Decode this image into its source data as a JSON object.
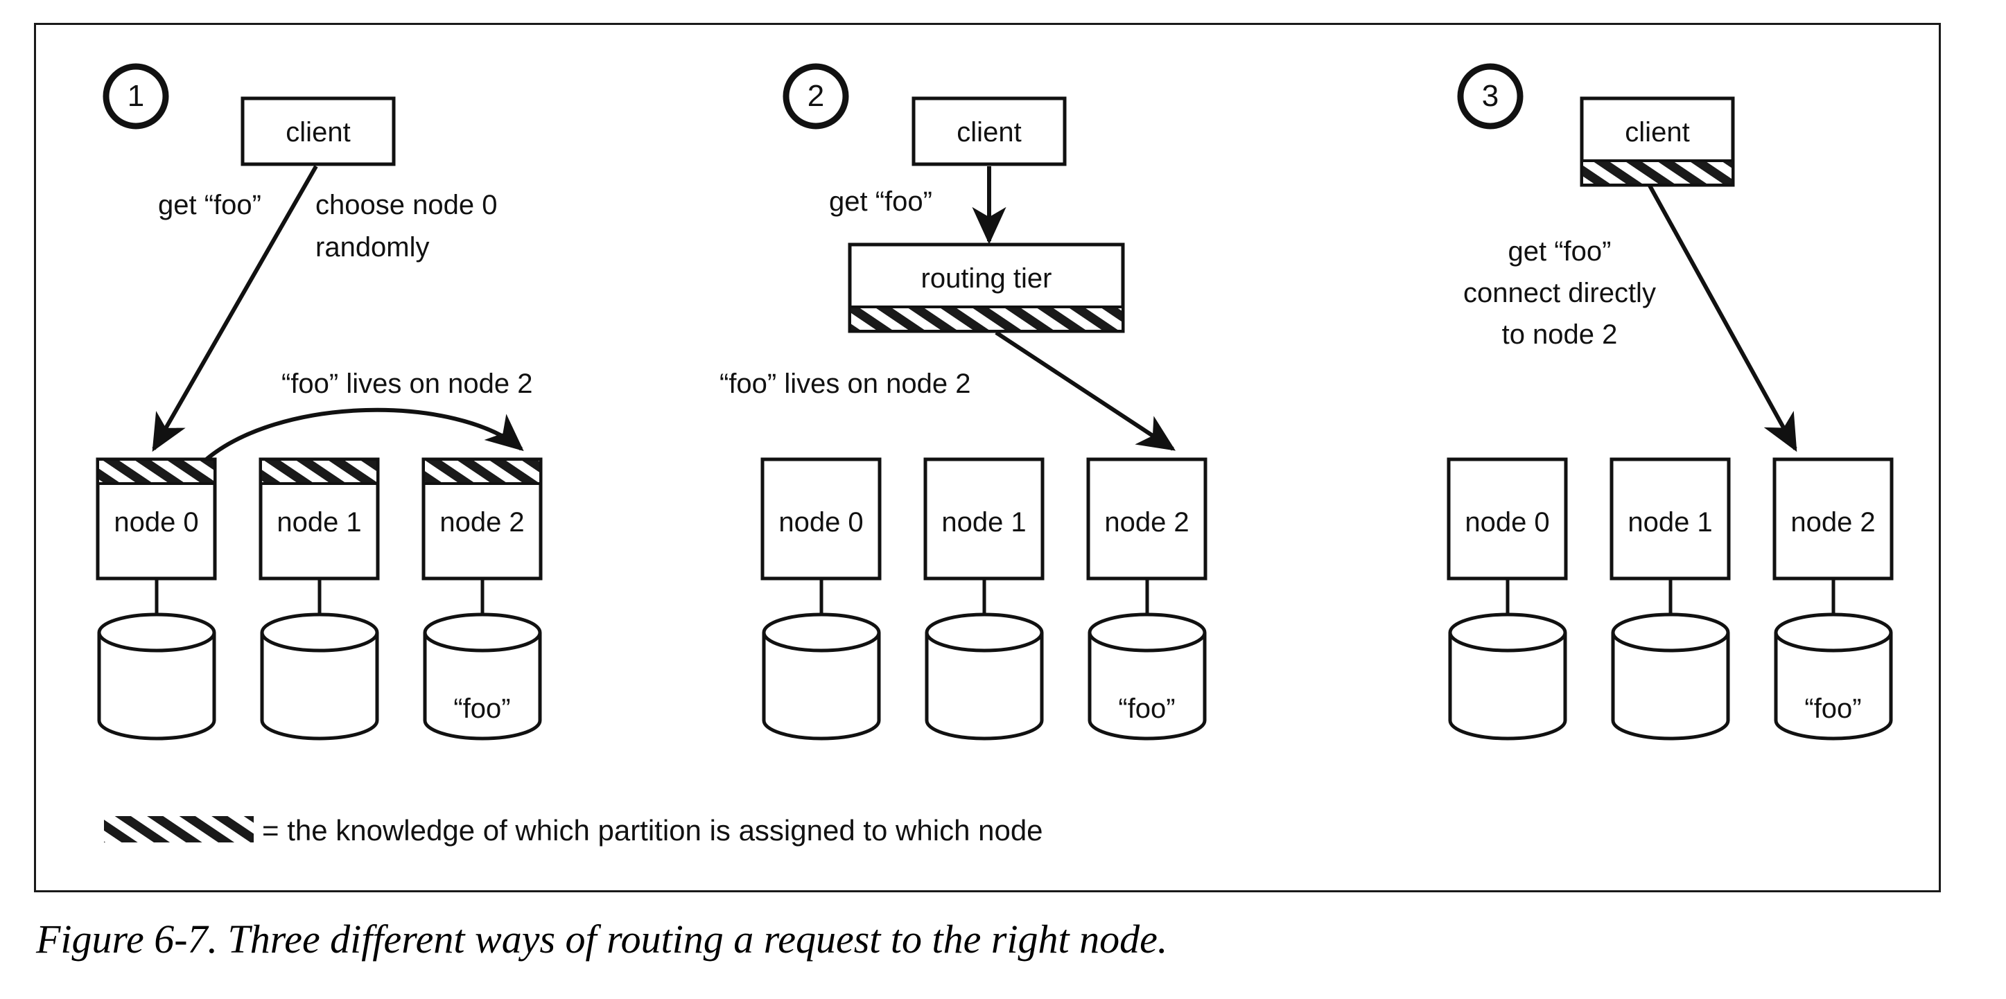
{
  "figure": {
    "caption": "Figure 6-7. Three different ways of routing a request to the right node.",
    "frame_color": "#1a1a1a",
    "background": "#ffffff"
  },
  "legend": {
    "swatch_name": "hatched-bar",
    "text": "= the knowledge of which partition is assigned to which node"
  },
  "panels": [
    {
      "number": "1",
      "client": {
        "label": "client",
        "hatched": false,
        "hatch_position": "none"
      },
      "annotations": [
        {
          "name": "request-label",
          "text": "get “foo”"
        },
        {
          "name": "choose-label-line1",
          "text": "choose node 0"
        },
        {
          "name": "choose-label-line2",
          "text": "randomly"
        },
        {
          "name": "forward-label",
          "text": "“foo” lives on node 2"
        }
      ],
      "nodes": [
        {
          "label": "node 0",
          "hatched": true,
          "hatch_position": "top",
          "store_label": ""
        },
        {
          "label": "node 1",
          "hatched": true,
          "hatch_position": "top",
          "store_label": ""
        },
        {
          "label": "node 2",
          "hatched": true,
          "hatch_position": "top",
          "store_label": "“foo”"
        }
      ]
    },
    {
      "number": "2",
      "client": {
        "label": "client",
        "hatched": false,
        "hatch_position": "none"
      },
      "router": {
        "label": "routing tier",
        "hatched": true,
        "hatch_position": "bottom"
      },
      "annotations": [
        {
          "name": "request-label",
          "text": "get “foo”"
        },
        {
          "name": "forward-label",
          "text": "“foo” lives on node 2"
        }
      ],
      "nodes": [
        {
          "label": "node 0",
          "hatched": false,
          "hatch_position": "none",
          "store_label": ""
        },
        {
          "label": "node 1",
          "hatched": false,
          "hatch_position": "none",
          "store_label": ""
        },
        {
          "label": "node 2",
          "hatched": false,
          "hatch_position": "none",
          "store_label": "“foo”"
        }
      ]
    },
    {
      "number": "3",
      "client": {
        "label": "client",
        "hatched": true,
        "hatch_position": "bottom"
      },
      "annotations": [
        {
          "name": "request-label-line1",
          "text": "get “foo”"
        },
        {
          "name": "request-label-line2",
          "text": "connect directly"
        },
        {
          "name": "request-label-line3",
          "text": "to node 2"
        }
      ],
      "nodes": [
        {
          "label": "node 0",
          "hatched": false,
          "hatch_position": "none",
          "store_label": ""
        },
        {
          "label": "node 1",
          "hatched": false,
          "hatch_position": "none",
          "store_label": ""
        },
        {
          "label": "node 2",
          "hatched": false,
          "hatch_position": "none",
          "store_label": "“foo”"
        }
      ]
    }
  ]
}
